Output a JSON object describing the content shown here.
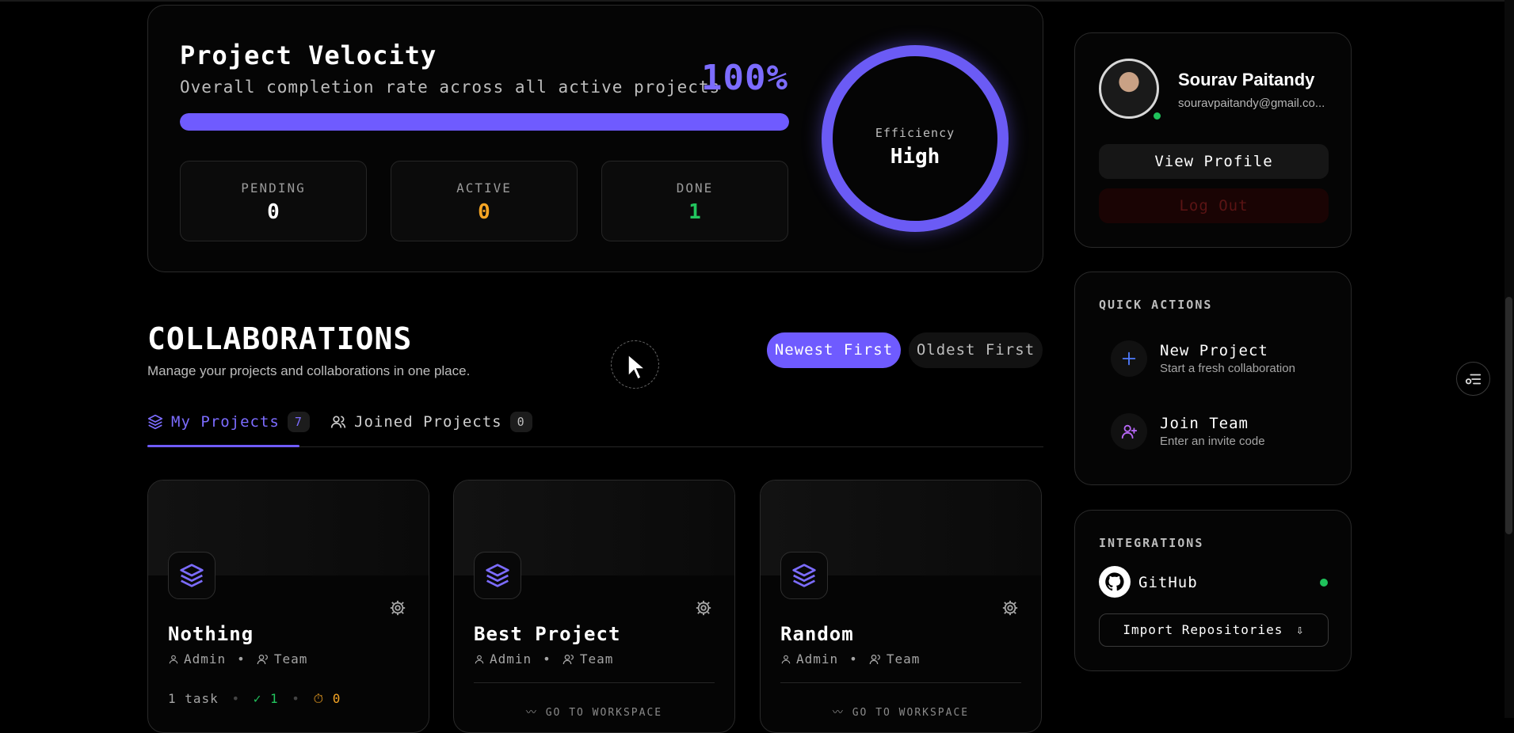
{
  "velocity": {
    "title": "Project Velocity",
    "subtitle": "Overall completion rate across all active projects",
    "percent_label": "100%",
    "progress": 1.0,
    "stats": [
      {
        "label": "PENDING",
        "value": "0",
        "color": "#ffffff"
      },
      {
        "label": "ACTIVE",
        "value": "0",
        "color": "#f5a524"
      },
      {
        "label": "DONE",
        "value": "1",
        "color": "#22c55e"
      }
    ],
    "efficiency_label": "Efficiency",
    "efficiency_value": "High"
  },
  "collab": {
    "title": "COLLABORATIONS",
    "subtitle": "Manage your projects and collaborations in one place.",
    "sort_newest": "Newest First",
    "sort_oldest": "Oldest First",
    "tabs": [
      {
        "label": "My Projects",
        "count": "7",
        "active": true
      },
      {
        "label": "Joined Projects",
        "count": "0",
        "active": false
      }
    ],
    "projects": [
      {
        "name": "Nothing",
        "role": "Admin",
        "type": "Team",
        "tasks": "1 task",
        "done": "1",
        "pending": "0"
      },
      {
        "name": "Best Project",
        "role": "Admin",
        "type": "Team",
        "workspace": "GO TO WORKSPACE"
      },
      {
        "name": "Random",
        "role": "Admin",
        "type": "Team",
        "workspace": "GO TO WORKSPACE"
      }
    ]
  },
  "profile": {
    "name": "Sourav Paitandy",
    "email": "souravpaitandy@gmail.co...",
    "view_profile": "View Profile",
    "logout": "Log Out"
  },
  "quick_actions": {
    "heading": "QUICK ACTIONS",
    "items": [
      {
        "title": "New Project",
        "subtitle": "Start a fresh collaboration",
        "icon": "plus-icon"
      },
      {
        "title": "Join Team",
        "subtitle": "Enter an invite code",
        "icon": "user-plus-icon"
      }
    ]
  },
  "integrations": {
    "heading": "INTEGRATIONS",
    "github": "GitHub",
    "import_label": "Import Repositories"
  },
  "colors": {
    "accent": "#6f5bff",
    "success": "#22c55e",
    "warning": "#f5a524"
  }
}
